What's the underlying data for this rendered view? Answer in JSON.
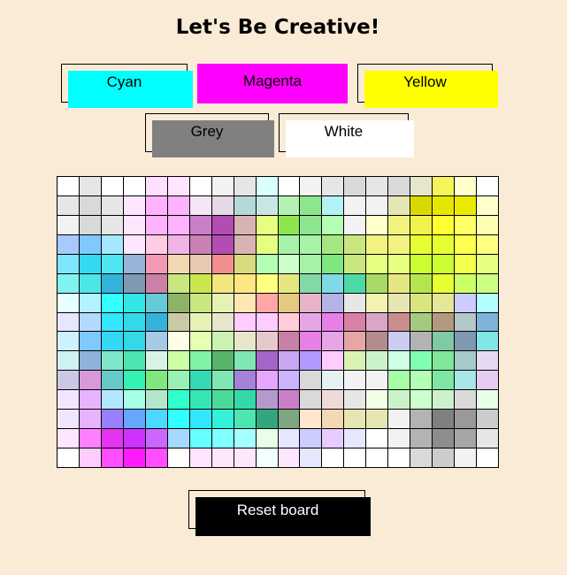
{
  "title": "Let's Be Creative!",
  "buttons": [
    {
      "label": "Cyan",
      "color": "#00ffff"
    },
    {
      "label": "Magenta",
      "color": "#ff00ff"
    },
    {
      "label": "Yellow",
      "color": "#ffff00"
    },
    {
      "label": "Grey",
      "color": "#808080"
    },
    {
      "label": "White",
      "color": "#ffffff"
    }
  ],
  "reset_label": "Reset board",
  "board": {
    "columns": 20,
    "rows": 15,
    "cells": [
      [
        "#ffffff",
        "#e6e6e6",
        "#ffffff",
        "#ffffff",
        "#ffdfff",
        "#ffe6ff",
        "#ffffff",
        "#f2f2f2",
        "#e6e6e6",
        "#d9ffff",
        "#ffffff",
        "#f2f2f2",
        "#e6e6e6",
        "#d9d9d9",
        "#e6e6e6",
        "#d9d9d9",
        "#e6e6c9",
        "#f5f55a",
        "#ffffcc",
        "#ffffff"
      ],
      [
        "#e6e6e6",
        "#d9d9d9",
        "#e6e6e6",
        "#ffe6ff",
        "#ffb3ff",
        "#ffb3ff",
        "#f5e6f5",
        "#e6d9e6",
        "#b3d9d9",
        "#c9e6e6",
        "#b3f2b3",
        "#8de68d",
        "#b3f2f2",
        "#f2f2f2",
        "#f2f2f2",
        "#e6e6b3",
        "#d9d900",
        "#e6e600",
        "#eaea00",
        "#ffffcc"
      ],
      [
        "#f2f2f2",
        "#d9d9d9",
        "#e6e6e6",
        "#ffe6ff",
        "#ffb3ff",
        "#ffb3ff",
        "#c980c9",
        "#b34db3",
        "#d9b3b3",
        "#e6ff80",
        "#8de64d",
        "#8de68d",
        "#b3ffb3",
        "#f2f2f2",
        "#ffffcc",
        "#f2f280",
        "#f2f24d",
        "#ffff33",
        "#ffff66",
        "#ffffb3"
      ],
      [
        "#a6c9ff",
        "#80c9ff",
        "#a6e6ff",
        "#ffe6ff",
        "#ffcce6",
        "#f2b3e6",
        "#c980b3",
        "#b34db3",
        "#d9b3b3",
        "#e6ff80",
        "#a6f2a6",
        "#a6f2a6",
        "#a6e680",
        "#c9e680",
        "#f2f280",
        "#f2f280",
        "#e6ff33",
        "#e6ff33",
        "#ffff4d",
        "#ffff80"
      ],
      [
        "#80e6ff",
        "#33d9f2",
        "#4de6f2",
        "#99b3d9",
        "#f299b3",
        "#f2d9b3",
        "#e6c9b3",
        "#f28d8d",
        "#d9d980",
        "#b3ffb3",
        "#ccffcc",
        "#a6f2a6",
        "#80e680",
        "#c9e680",
        "#e6ff80",
        "#e6ff80",
        "#ccff33",
        "#ccff33",
        "#f2ff4d",
        "#e6ff80"
      ],
      [
        "#80f2f2",
        "#4de6e6",
        "#33b3d9",
        "#8099b3",
        "#cc80a6",
        "#c9e680",
        "#c9e64d",
        "#f2e680",
        "#ffe680",
        "#ffff80",
        "#e6e680",
        "#80d9a6",
        "#80d9e6",
        "#4dd9a6",
        "#a6d966",
        "#e6e680",
        "#b3e64d",
        "#e6ff33",
        "#ccff66",
        "#ccff80"
      ],
      [
        "#e6ffff",
        "#b3f2ff",
        "#33ffff",
        "#33e6e6",
        "#66c9d9",
        "#8db366",
        "#c9e680",
        "#e6f2b3",
        "#ffe6b3",
        "#ffa6a6",
        "#e6c980",
        "#e6b3c9",
        "#b3b3e6",
        "#e6e6e6",
        "#f2f2b3",
        "#e6e6b3",
        "#d9e680",
        "#e6e699",
        "#ccccff",
        "#b3ffff"
      ],
      [
        "#e6e6ff",
        "#b3d9ff",
        "#33e6ff",
        "#33d9e6",
        "#33b3d9",
        "#c9c9a6",
        "#e6f2b3",
        "#e6e6cc",
        "#ffccff",
        "#ffccff",
        "#ffccd9",
        "#e6a6e6",
        "#e680e6",
        "#d980a6",
        "#d9a6c9",
        "#c98d8d",
        "#a6c980",
        "#b39980",
        "#b3c9c9",
        "#80b3d9"
      ],
      [
        "#ccf2ff",
        "#80c9ff",
        "#33d9f2",
        "#33d9e6",
        "#a6c9e6",
        "#ffffe6",
        "#e6ffb3",
        "#ccf2b3",
        "#e6e6cc",
        "#e6c9c9",
        "#c980a6",
        "#e680e6",
        "#e6a6e6",
        "#e6a6a6",
        "#b38d8d",
        "#ccccf2",
        "#b3b3b3",
        "#80c9a6",
        "#8099b3",
        "#80e6e6"
      ],
      [
        "#ccf2f2",
        "#8db3d9",
        "#80e6c9",
        "#4de6b3",
        "#d9f2e6",
        "#ccffa6",
        "#80f2a6",
        "#59b36b",
        "#80e6b3",
        "#a666c9",
        "#c9a6f2",
        "#b399ff",
        "#ffccff",
        "#d9f2b3",
        "#ccf2cc",
        "#ccffe6",
        "#80ffb3",
        "#80e699",
        "#a6c9c9",
        "#e6d9f2"
      ],
      [
        "#c9c9e6",
        "#d999d9",
        "#66c9c9",
        "#33f2b3",
        "#80e680",
        "#99f2b3",
        "#33d9b3",
        "#80e6b3",
        "#a680d9",
        "#e6a6ff",
        "#ccb3ff",
        "#d9d9d9",
        "#e6f2f2",
        "#f2f2f2",
        "#f2f2f2",
        "#a6ffa6",
        "#b3ffb3",
        "#80e6a6",
        "#a6e6e6",
        "#e6ccf2"
      ],
      [
        "#f2e6ff",
        "#e6b3ff",
        "#b3e6ff",
        "#a6ffe6",
        "#b3e6cc",
        "#33ffcc",
        "#33e6b3",
        "#4dd999",
        "#33d9a6",
        "#b399cc",
        "#c980c9",
        "#d9d9d9",
        "#f2d9d9",
        "#e6e6e6",
        "#f2ffe6",
        "#c9f2c9",
        "#ccffcc",
        "#ccf2cc",
        "#d9d9d9",
        "#e6ffe6"
      ],
      [
        "#f2e6ff",
        "#e6b3ff",
        "#9980ff",
        "#66a6ff",
        "#4dd9ff",
        "#33ffff",
        "#33e6ff",
        "#33f2d9",
        "#4de6b3",
        "#33a680",
        "#80a680",
        "#ffe6cc",
        "#f2d9b3",
        "#e6e6b3",
        "#e6e6b3",
        "#f2f2f2",
        "#b3b3b3",
        "#808080",
        "#999999",
        "#cccccc"
      ],
      [
        "#ffe6ff",
        "#ff80ff",
        "#e633f2",
        "#cc33ff",
        "#cc66ff",
        "#a6d9ff",
        "#66ffff",
        "#80ffff",
        "#a6ffff",
        "#e6ffe6",
        "#e6e6ff",
        "#ccccff",
        "#e6ccff",
        "#e6e6ff",
        "#ffffff",
        "#f2f2f2",
        "#b3b3b3",
        "#8d8d8d",
        "#a6a6a6",
        "#e6e6e6"
      ],
      [
        "#ffffff",
        "#ffccff",
        "#ff4dff",
        "#ff1aff",
        "#ff4dff",
        "#ffffff",
        "#ffe6ff",
        "#ffe6ff",
        "#ffe6ff",
        "#f2ffff",
        "#ffe6ff",
        "#e6e6ff",
        "#ffffff",
        "#ffffff",
        "#ffffff",
        "#ffffff",
        "#d9d9d9",
        "#cccccc",
        "#f2f2f2",
        "#ffffff"
      ]
    ]
  }
}
